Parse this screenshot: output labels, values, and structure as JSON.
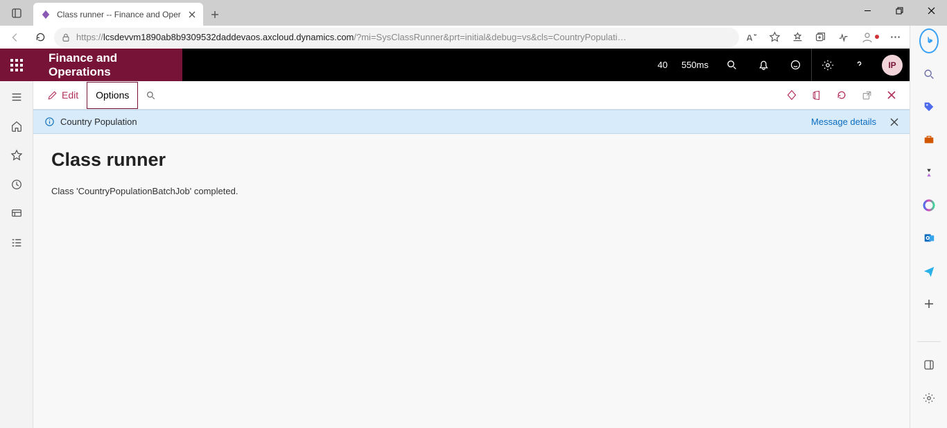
{
  "browser": {
    "tab_title": "Class runner -- Finance and Oper",
    "url_host": "lcsdevvm1890ab8b9309532daddevaos.axcloud.dynamics.com",
    "url_path": "/?mi=SysClassRunner&prt=initial&debug=vs&cls=CountryPopulati…"
  },
  "app": {
    "brand": "Finance and Operations",
    "stats": {
      "count": "40",
      "timing": "550ms"
    },
    "avatar_initials": "IP"
  },
  "action_bar": {
    "edit": "Edit",
    "options": "Options"
  },
  "message_bar": {
    "text": "Country Population",
    "details": "Message details"
  },
  "page": {
    "title": "Class runner",
    "body": "Class 'CountryPopulationBatchJob' completed."
  }
}
